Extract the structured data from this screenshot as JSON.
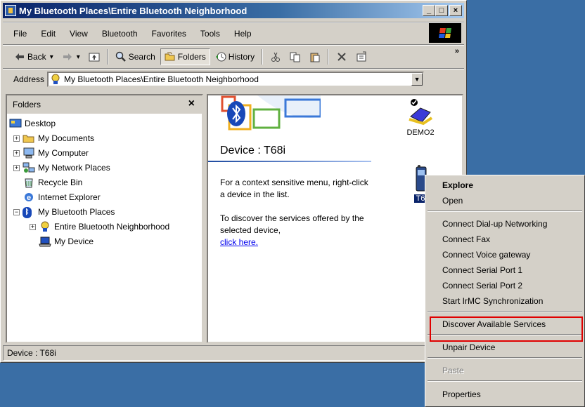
{
  "window": {
    "title": "My Bluetooth Places\\Entire Bluetooth Neighborhood",
    "minimize": "_",
    "maximize": "□",
    "close": "×"
  },
  "menu": [
    "File",
    "Edit",
    "View",
    "Bluetooth",
    "Favorites",
    "Tools",
    "Help"
  ],
  "toolbar": {
    "back": "Back",
    "search": "Search",
    "folders": "Folders",
    "history": "History",
    "more": "»"
  },
  "address": {
    "label": "Address",
    "value": "My Bluetooth Places\\Entire Bluetooth Neighborhood"
  },
  "folders": {
    "title": "Folders",
    "close": "×",
    "items": [
      {
        "label": "Desktop",
        "icon": "desktop-icon",
        "expander": ""
      },
      {
        "label": "My Documents",
        "icon": "folder-icon",
        "expander": "+"
      },
      {
        "label": "My Computer",
        "icon": "computer-icon",
        "expander": "+"
      },
      {
        "label": "My Network Places",
        "icon": "network-icon",
        "expander": "+"
      },
      {
        "label": "Recycle Bin",
        "icon": "recycle-bin-icon",
        "expander": ""
      },
      {
        "label": "Internet Explorer",
        "icon": "ie-icon",
        "expander": ""
      },
      {
        "label": "My Bluetooth Places",
        "icon": "bluetooth-icon",
        "expander": "−"
      },
      {
        "label": "Entire Bluetooth Neighborhood",
        "icon": "bluetooth-neighborhood-icon",
        "expander": "+"
      },
      {
        "label": "My Device",
        "icon": "laptop-icon",
        "expander": ""
      }
    ]
  },
  "content": {
    "device_title": "Device : T68i",
    "info1": "For a context sensitive menu, right-click a device in the list.",
    "info2": "To discover the services offered by the selected device,",
    "link": "click here.",
    "devices": [
      {
        "label": "DEMO2",
        "icon": "device-connected-icon"
      },
      {
        "label": "T6",
        "icon": "phone-icon"
      }
    ]
  },
  "status": {
    "text": "Device : T68i"
  },
  "context_menu": {
    "items": [
      {
        "label": "Explore",
        "bold": true
      },
      {
        "label": "Open"
      },
      {
        "label": "Connect Dial-up Networking"
      },
      {
        "label": "Connect Fax"
      },
      {
        "label": "Connect Voice gateway"
      },
      {
        "label": "Connect Serial Port 1"
      },
      {
        "label": "Connect Serial Port 2"
      },
      {
        "label": "Start IrMC Synchronization"
      },
      {
        "label": "Discover Available Services"
      },
      {
        "label": "Unpair Device"
      },
      {
        "label": "Paste",
        "disabled": true
      },
      {
        "label": "Properties"
      }
    ]
  },
  "colors": {
    "desktop": "#3a6ea5",
    "titlebar": "#0a246a",
    "highlight_box": "#e00000"
  }
}
